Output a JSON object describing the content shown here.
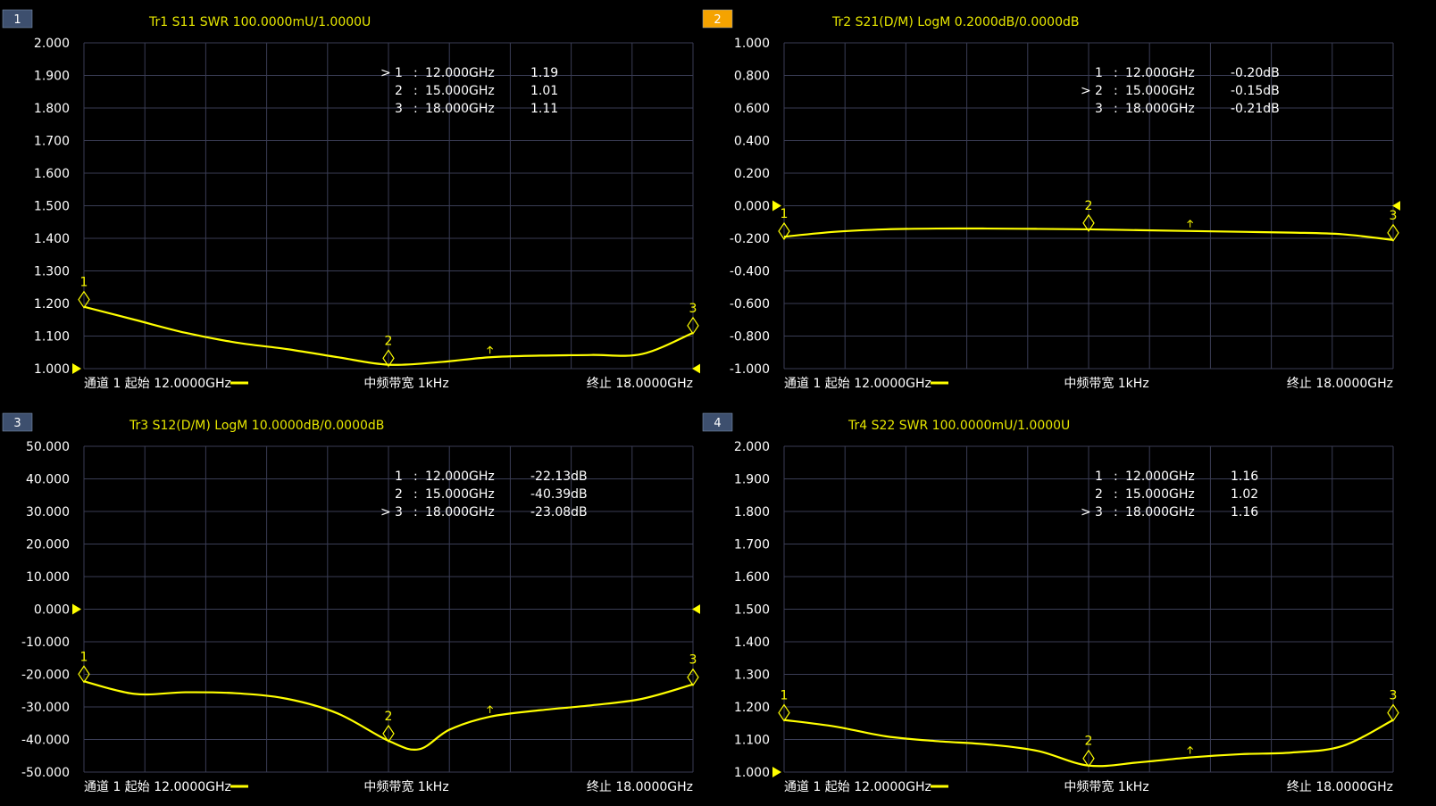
{
  "colors": {
    "background": "#000000",
    "grid": "#3a3d55",
    "trace": "#ffff00",
    "title_text": "#e6e600",
    "axis_text": "#ffffff",
    "footer_text": "#ffffff",
    "badge_inactive": "#3d4f6e",
    "badge_active": "#f5a300"
  },
  "panels": [
    {
      "number": "1",
      "active": false,
      "title": "Tr1 S11 SWR 100.0000mU/1.0000U",
      "footer": {
        "start": "通道 1 起始 12.0000GHz",
        "center": "中频带宽 1kHz",
        "stop": "终止 18.0000GHz"
      },
      "ref_markers": {
        "left": true,
        "right": true
      },
      "markers": [
        {
          "id": "1",
          "active": true,
          "freq": "12.000GHz",
          "value": "1.19"
        },
        {
          "id": "2",
          "active": false,
          "freq": "15.000GHz",
          "value": "1.01"
        },
        {
          "id": "3",
          "active": false,
          "freq": "18.000GHz",
          "value": "1.11"
        }
      ]
    },
    {
      "number": "2",
      "active": true,
      "title": "Tr2 S21(D/M) LogM 0.2000dB/0.0000dB",
      "footer": {
        "start": "通道 1 起始 12.0000GHz",
        "center": "中频带宽 1kHz",
        "stop": "终止 18.0000GHz"
      },
      "ref_markers": {
        "left": true,
        "right": true
      },
      "markers": [
        {
          "id": "1",
          "active": false,
          "freq": "12.000GHz",
          "value": "-0.20dB"
        },
        {
          "id": "2",
          "active": true,
          "freq": "15.000GHz",
          "value": "-0.15dB"
        },
        {
          "id": "3",
          "active": false,
          "freq": "18.000GHz",
          "value": "-0.21dB"
        }
      ]
    },
    {
      "number": "3",
      "active": false,
      "title": "Tr3 S12(D/M) LogM 10.0000dB/0.0000dB",
      "footer": {
        "start": "通道 1 起始 12.0000GHz",
        "center": "中频带宽 1kHz",
        "stop": "终止 18.0000GHz"
      },
      "ref_markers": {
        "left": true,
        "right": true
      },
      "markers": [
        {
          "id": "1",
          "active": false,
          "freq": "12.000GHz",
          "value": "-22.13dB"
        },
        {
          "id": "2",
          "active": false,
          "freq": "15.000GHz",
          "value": "-40.39dB"
        },
        {
          "id": "3",
          "active": true,
          "freq": "18.000GHz",
          "value": "-23.08dB"
        }
      ]
    },
    {
      "number": "4",
      "active": false,
      "title": "Tr4 S22 SWR 100.0000mU/1.0000U",
      "footer": {
        "start": "通道 1 起始 12.0000GHz",
        "center": "中频带宽 1kHz",
        "stop": "终止 18.0000GHz"
      },
      "ref_markers": {
        "left": true,
        "right": false
      },
      "markers": [
        {
          "id": "1",
          "active": false,
          "freq": "12.000GHz",
          "value": "1.16"
        },
        {
          "id": "2",
          "active": false,
          "freq": "15.000GHz",
          "value": "1.02"
        },
        {
          "id": "3",
          "active": true,
          "freq": "18.000GHz",
          "value": "1.16"
        }
      ]
    }
  ],
  "chart_data": [
    {
      "type": "line",
      "title": "Tr1 S11 SWR 100.0000mU/1.0000U",
      "x_range_ghz": [
        12,
        18
      ],
      "ylim": [
        1.0,
        2.0
      ],
      "yticks": [
        "2.000",
        "1.900",
        "1.800",
        "1.700",
        "1.600",
        "1.500",
        "1.400",
        "1.300",
        "1.200",
        "1.100",
        "1.000"
      ],
      "grid": true,
      "x": [
        12.0,
        12.5,
        13.0,
        13.5,
        14.0,
        14.5,
        15.0,
        15.5,
        16.0,
        16.5,
        17.0,
        17.5,
        18.0
      ],
      "y": [
        1.19,
        1.15,
        1.11,
        1.08,
        1.06,
        1.035,
        1.012,
        1.02,
        1.035,
        1.04,
        1.042,
        1.045,
        1.11
      ],
      "markers_x": [
        12.0,
        15.0,
        18.0
      ],
      "markers_y": [
        1.19,
        1.01,
        1.11
      ]
    },
    {
      "type": "line",
      "title": "Tr2 S21(D/M) LogM 0.2000dB/0.0000dB",
      "x_range_ghz": [
        12,
        18
      ],
      "ylim": [
        -1.0,
        1.0
      ],
      "yticks": [
        "1.000",
        "0.800",
        "0.600",
        "0.400",
        "0.200",
        "0.000",
        "-0.200",
        "-0.400",
        "-0.600",
        "-0.800",
        "-1.000"
      ],
      "grid": true,
      "x": [
        12.0,
        12.5,
        13.0,
        13.5,
        14.0,
        14.5,
        15.0,
        15.5,
        16.0,
        16.5,
        17.0,
        17.5,
        18.0
      ],
      "y": [
        -0.19,
        -0.16,
        -0.145,
        -0.14,
        -0.14,
        -0.142,
        -0.145,
        -0.15,
        -0.155,
        -0.16,
        -0.165,
        -0.175,
        -0.21
      ],
      "markers_x": [
        12.0,
        15.0,
        18.0
      ],
      "markers_y": [
        -0.2,
        -0.15,
        -0.21
      ]
    },
    {
      "type": "line",
      "title": "Tr3 S12(D/M) LogM 10.0000dB/0.0000dB",
      "x_range_ghz": [
        12,
        18
      ],
      "ylim": [
        -50,
        50
      ],
      "yticks": [
        "50.000",
        "40.000",
        "30.000",
        "20.000",
        "10.000",
        "0.000",
        "-10.000",
        "-20.000",
        "-30.000",
        "-40.000",
        "-50.000"
      ],
      "grid": true,
      "x": [
        12.0,
        12.5,
        13.0,
        13.5,
        14.0,
        14.5,
        15.0,
        15.3,
        15.6,
        16.0,
        16.5,
        17.0,
        17.5,
        18.0
      ],
      "y": [
        -22.13,
        -26,
        -25.5,
        -25.8,
        -27.5,
        -32,
        -40.39,
        -43,
        -37,
        -33,
        -31,
        -29.5,
        -27.5,
        -23.08
      ],
      "markers_x": [
        12.0,
        15.0,
        18.0
      ],
      "markers_y": [
        -22.13,
        -40.39,
        -23.08
      ]
    },
    {
      "type": "line",
      "title": "Tr4 S22 SWR 100.0000mU/1.0000U",
      "x_range_ghz": [
        12,
        18
      ],
      "ylim": [
        1.0,
        2.0
      ],
      "yticks": [
        "2.000",
        "1.900",
        "1.800",
        "1.700",
        "1.600",
        "1.500",
        "1.400",
        "1.300",
        "1.200",
        "1.100",
        "1.000"
      ],
      "grid": true,
      "x": [
        12.0,
        12.5,
        13.0,
        13.5,
        14.0,
        14.5,
        15.0,
        15.5,
        16.0,
        16.5,
        17.0,
        17.5,
        18.0
      ],
      "y": [
        1.16,
        1.14,
        1.11,
        1.095,
        1.085,
        1.065,
        1.02,
        1.03,
        1.045,
        1.055,
        1.06,
        1.08,
        1.16
      ],
      "markers_x": [
        12.0,
        15.0,
        18.0
      ],
      "markers_y": [
        1.16,
        1.02,
        1.16
      ]
    }
  ]
}
